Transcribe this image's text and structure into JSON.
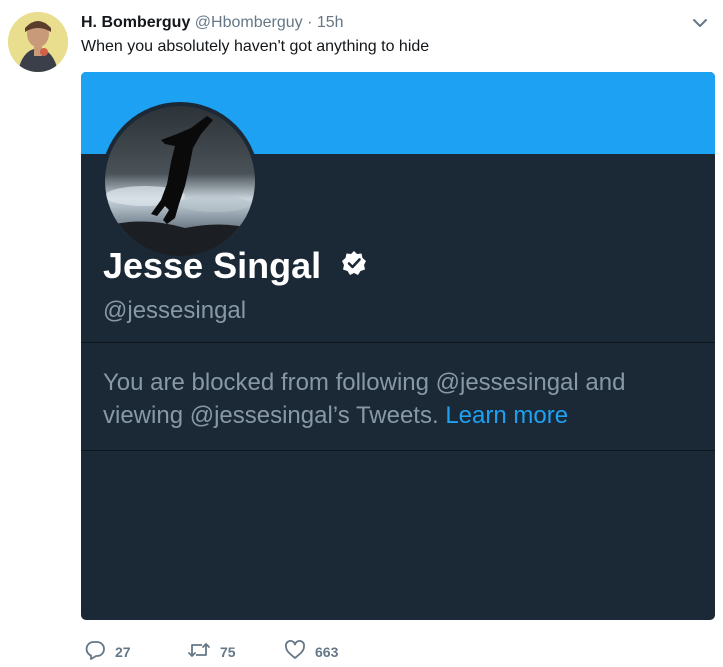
{
  "tweet": {
    "author_name": "H. Bomberguy",
    "author_handle": "@Hbomberguy",
    "separator": "·",
    "timestamp": "15h",
    "text": "When you absolutely haven't got anything to hide"
  },
  "card": {
    "banner_color": "#1da1f2",
    "background_color": "#1b2836",
    "profile_name": "Jesse Singal",
    "profile_handle": "@jessesingal",
    "verified": true,
    "blocked_message": "You are blocked from following @jessesingal and viewing @jessesingal’s Tweets.",
    "learn_more_label": "Learn more"
  },
  "actions": {
    "reply_count": "27",
    "retweet_count": "75",
    "like_count": "663"
  },
  "icons": {
    "caret": "chevron-down-icon",
    "reply": "reply-icon",
    "retweet": "retweet-icon",
    "like": "heart-icon",
    "verified": "verified-badge-icon"
  }
}
